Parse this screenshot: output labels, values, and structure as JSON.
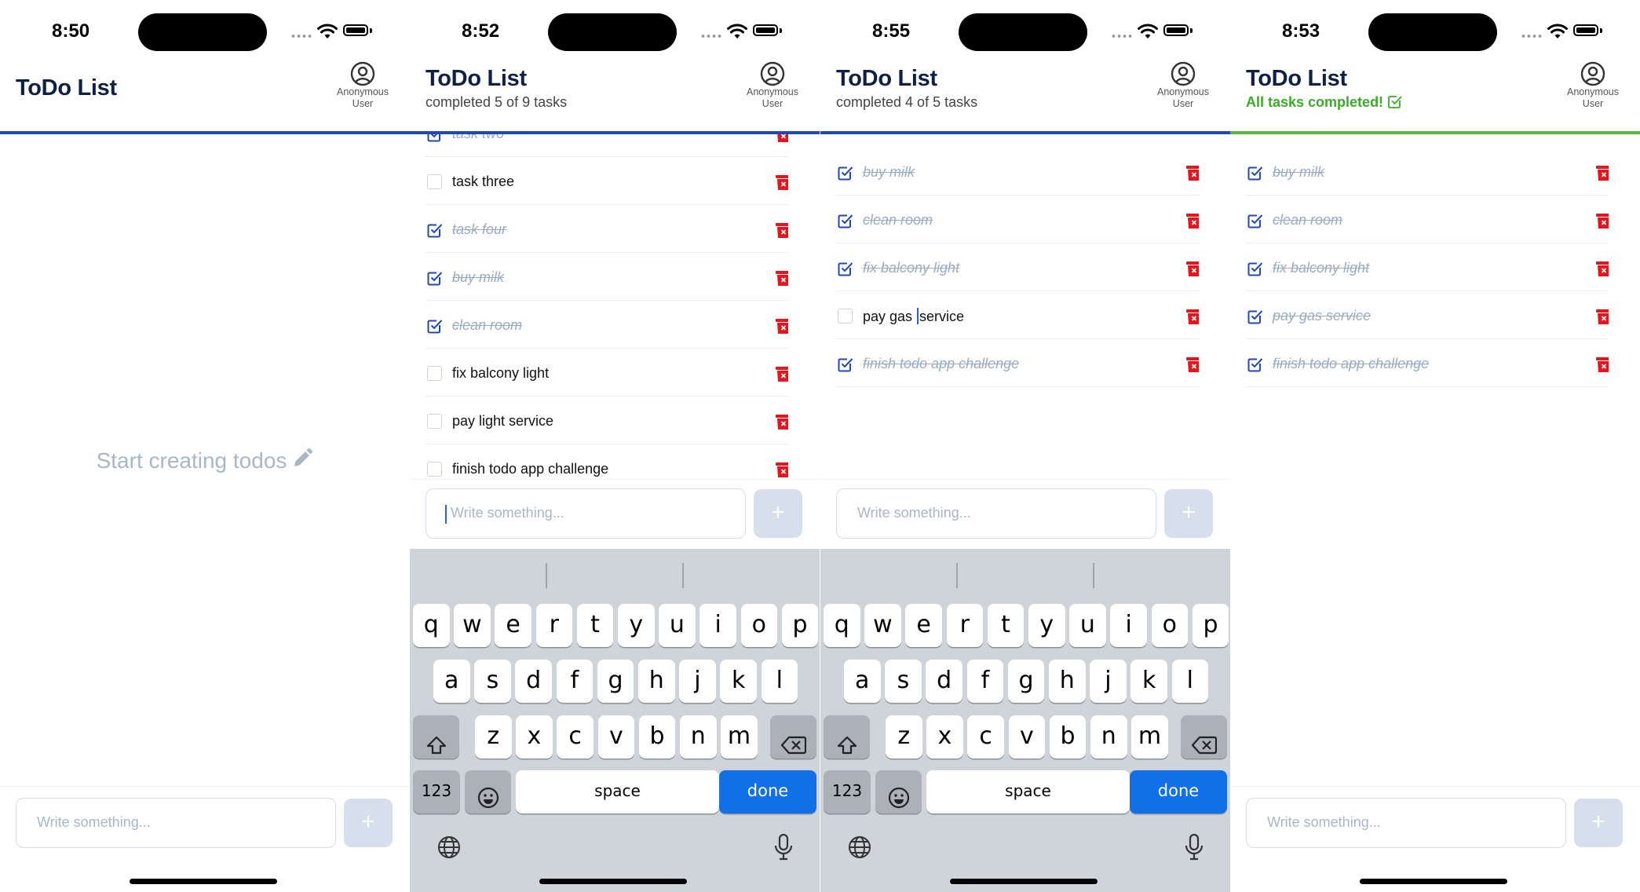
{
  "app": {
    "title": "ToDo List"
  },
  "colors": {
    "primary": "#1f49b6",
    "success": "#3aab28",
    "danger": "#e8141b",
    "done_text": "#9aabc2",
    "keyboard_done": "#1170e8"
  },
  "user": {
    "label_line1": "Anonymous",
    "label_line2": "User",
    "icon": "user-circle-icon"
  },
  "input": {
    "placeholder": "Write something...",
    "add_label": "+"
  },
  "keyboard": {
    "row1": [
      "q",
      "w",
      "e",
      "r",
      "t",
      "y",
      "u",
      "i",
      "o",
      "p"
    ],
    "row2": [
      "a",
      "s",
      "d",
      "f",
      "g",
      "h",
      "j",
      "k",
      "l"
    ],
    "row3": [
      "z",
      "x",
      "c",
      "v",
      "b",
      "n",
      "m"
    ],
    "numbers_label": "123",
    "space_label": "space",
    "done_label": "done"
  },
  "screens": [
    {
      "time": "8:50",
      "empty_message": "Start creating todos",
      "todos": []
    },
    {
      "time": "8:52",
      "status": "completed 5 of 9 tasks",
      "todos": [
        {
          "text": "task two",
          "done": true
        },
        {
          "text": "task three",
          "done": false
        },
        {
          "text": "task four",
          "done": true
        },
        {
          "text": "buy milk",
          "done": true
        },
        {
          "text": "clean room",
          "done": true
        },
        {
          "text": "fix balcony light",
          "done": false
        },
        {
          "text": "pay light service",
          "done": false
        },
        {
          "text": "finish todo app challenge",
          "done": false
        }
      ]
    },
    {
      "time": "8:55",
      "status": "completed 4 of 5 tasks",
      "todos": [
        {
          "text": "buy milk",
          "done": true
        },
        {
          "text": "clean room",
          "done": true
        },
        {
          "text": "fix balcony light",
          "done": true
        },
        {
          "text_before_caret": "pay gas ",
          "text_after_caret": "service",
          "done": false
        },
        {
          "text": "finish todo app challenge",
          "done": true
        }
      ]
    },
    {
      "time": "8:53",
      "status": "All tasks completed!",
      "todos": [
        {
          "text": "buy milk",
          "done": true
        },
        {
          "text": "clean room",
          "done": true
        },
        {
          "text": "fix balcony light",
          "done": true
        },
        {
          "text": "pay gas service",
          "done": true
        },
        {
          "text": "finish todo app challenge",
          "done": true
        }
      ]
    }
  ]
}
